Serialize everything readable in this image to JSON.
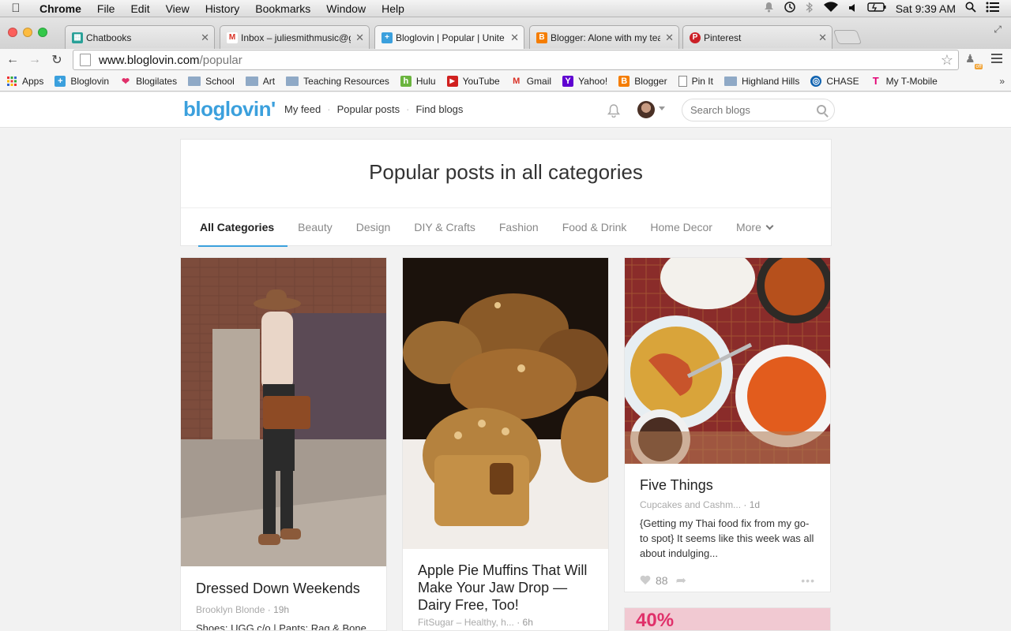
{
  "menubar": {
    "app": "Chrome",
    "items": [
      "File",
      "Edit",
      "View",
      "History",
      "Bookmarks",
      "Window",
      "Help"
    ],
    "clock": "Sat 9:39 AM"
  },
  "tabs": [
    {
      "label": "Chatbooks",
      "icon": "chatbooks-icon",
      "color": "#2aa198"
    },
    {
      "label": "Inbox – juliesmithmusic@g",
      "icon": "gmail-icon",
      "color": "#d93025"
    },
    {
      "label": "Bloglovin | Popular | Unite",
      "icon": "bloglovin-icon",
      "color": "#3ba0dd"
    },
    {
      "label": "Blogger: Alone with my tea",
      "icon": "blogger-icon",
      "color": "#f57d00"
    },
    {
      "label": "Pinterest",
      "icon": "pinterest-icon",
      "color": "#cb2027"
    }
  ],
  "url": {
    "host": "www.bloglovin.com",
    "path": "/popular"
  },
  "extension": {
    "badge": "off"
  },
  "bookmarks": [
    {
      "label": "Apps",
      "icon": "apps-grid-icon"
    },
    {
      "label": "Bloglovin",
      "icon": "bloglovin-icon"
    },
    {
      "label": "Blogilates",
      "icon": "heart-icon"
    },
    {
      "label": "School",
      "icon": "folder-icon"
    },
    {
      "label": "Art",
      "icon": "folder-icon"
    },
    {
      "label": "Teaching Resources",
      "icon": "folder-icon"
    },
    {
      "label": "Hulu",
      "icon": "hulu-icon"
    },
    {
      "label": "YouTube",
      "icon": "youtube-icon"
    },
    {
      "label": "Gmail",
      "icon": "gmail-icon"
    },
    {
      "label": "Yahoo!",
      "icon": "yahoo-icon"
    },
    {
      "label": "Blogger",
      "icon": "blogger-icon"
    },
    {
      "label": "Pin It",
      "icon": "page-icon"
    },
    {
      "label": "Highland Hills",
      "icon": "folder-icon"
    },
    {
      "label": "CHASE",
      "icon": "chase-icon"
    },
    {
      "label": "My T-Mobile",
      "icon": "tmobile-icon"
    }
  ],
  "bookmarks_more": "»",
  "site": {
    "logo": "bloglovin'",
    "nav": [
      "My feed",
      "Popular posts",
      "Find blogs"
    ],
    "search_placeholder": "Search blogs"
  },
  "page": {
    "heading": "Popular posts in all categories",
    "categories": [
      "All Categories",
      "Beauty",
      "Design",
      "DIY & Crafts",
      "Fashion",
      "Food & Drink",
      "Home Decor",
      "More"
    ]
  },
  "posts": [
    {
      "title": "Dressed Down Weekends",
      "source": "Brooklyn Blonde",
      "time": "· 19h",
      "desc": "Shoes: UGG c/o | Pants: Rag & Bone"
    },
    {
      "title": "Apple Pie Muffins That Will Make Your Jaw Drop — Dairy Free, Too!",
      "source": "FitSugar – Healthy, h...",
      "time": "· 6h"
    },
    {
      "title": "Five Things",
      "source": "Cupcakes and Cashm...",
      "time": "· 1d",
      "desc": "{Getting my Thai food fix from my go-to spot} It seems like this week was all about indulging...",
      "likes": "88"
    },
    {
      "overlay": "40%"
    }
  ]
}
